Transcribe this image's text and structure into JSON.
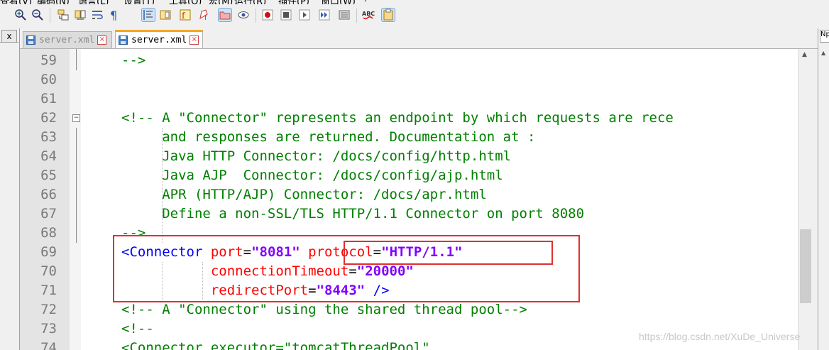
{
  "app": {
    "accent_color": "#f5a623",
    "highlight_color": "#e03030"
  },
  "menubar": {
    "items": [
      "查看(V)",
      "编码(N)",
      "语言(L)",
      "设置(T)",
      "工具(O)",
      "宏(M)",
      "运行(R)",
      "插件(P)",
      "窗口(W)",
      "?"
    ]
  },
  "toolbar": {
    "buttons": [
      "zoom-in-icon",
      "zoom-out-icon",
      "sync-vertical-icon",
      "sync-horizontal-icon",
      "word-wrap-icon",
      "show-all-chars-icon",
      "indent-guide-icon",
      "doc-map-icon",
      "function-list-icon",
      "folder-workspace-icon",
      "monitoring-icon",
      "record-macro-icon",
      "stop-recording-icon",
      "play-macro-icon",
      "run-macro-multiple-icon",
      "save-macro-icon",
      "spellcheck-icon",
      "clipboard-history-icon"
    ]
  },
  "left_panel": {
    "close_label": "x"
  },
  "tabs": [
    {
      "label": "server.xml",
      "active": false
    },
    {
      "label": "server.xml",
      "active": true
    }
  ],
  "right_panel": {
    "label": "Np"
  },
  "editor": {
    "lines": [
      {
        "num": "59",
        "segments": [
          {
            "t": "-->",
            "c": "c"
          }
        ]
      },
      {
        "num": "60",
        "segments": []
      },
      {
        "num": "61",
        "segments": []
      },
      {
        "num": "62",
        "segments": [
          {
            "t": "<!-- A \"Connector\" represents an endpoint by which requests are rece",
            "c": "c"
          }
        ]
      },
      {
        "num": "63",
        "segments": [
          {
            "t": "     and responses are returned. Documentation at :",
            "c": "c"
          }
        ]
      },
      {
        "num": "64",
        "segments": [
          {
            "t": "     Java HTTP Connector: /docs/config/http.html",
            "c": "c"
          }
        ]
      },
      {
        "num": "65",
        "segments": [
          {
            "t": "     Java AJP  Connector: /docs/config/ajp.html",
            "c": "c"
          }
        ]
      },
      {
        "num": "66",
        "segments": [
          {
            "t": "     APR (HTTP/AJP) Connector: /docs/apr.html",
            "c": "c"
          }
        ]
      },
      {
        "num": "67",
        "segments": [
          {
            "t": "     Define a non-SSL/TLS HTTP/1.1 Connector on port 8080",
            "c": "c"
          }
        ]
      },
      {
        "num": "68",
        "segments": [
          {
            "t": "-->",
            "c": "c"
          }
        ]
      },
      {
        "num": "69",
        "segments": [
          {
            "t": "<Connector",
            "c": "tag"
          },
          {
            "t": " ",
            "c": "eq"
          },
          {
            "t": "port",
            "c": "attr"
          },
          {
            "t": "=",
            "c": "eq"
          },
          {
            "t": "\"8081\"",
            "c": "val"
          },
          {
            "t": " ",
            "c": "eq"
          },
          {
            "t": "protocol",
            "c": "attr"
          },
          {
            "t": "=",
            "c": "eq"
          },
          {
            "t": "\"HTTP/1.1\"",
            "c": "val"
          }
        ]
      },
      {
        "num": "70",
        "segments": [
          {
            "t": "           ",
            "c": "eq"
          },
          {
            "t": "connectionTimeout",
            "c": "attr"
          },
          {
            "t": "=",
            "c": "eq"
          },
          {
            "t": "\"20000\"",
            "c": "val"
          }
        ]
      },
      {
        "num": "71",
        "segments": [
          {
            "t": "           ",
            "c": "eq"
          },
          {
            "t": "redirectPort",
            "c": "attr"
          },
          {
            "t": "=",
            "c": "eq"
          },
          {
            "t": "\"8443\"",
            "c": "val"
          },
          {
            "t": " />",
            "c": "tag"
          }
        ]
      },
      {
        "num": "72",
        "segments": [
          {
            "t": "<!-- A \"Connector\" using the shared thread pool-->",
            "c": "c"
          }
        ]
      },
      {
        "num": "73",
        "segments": [
          {
            "t": "<!--",
            "c": "c"
          }
        ]
      },
      {
        "num": "74",
        "segments": [
          {
            "t": "<Connector executor=\"tomcatThreadPool\"",
            "c": "c"
          }
        ]
      }
    ]
  },
  "watermark": "https://blog.csdn.net/XuDe_Universe"
}
